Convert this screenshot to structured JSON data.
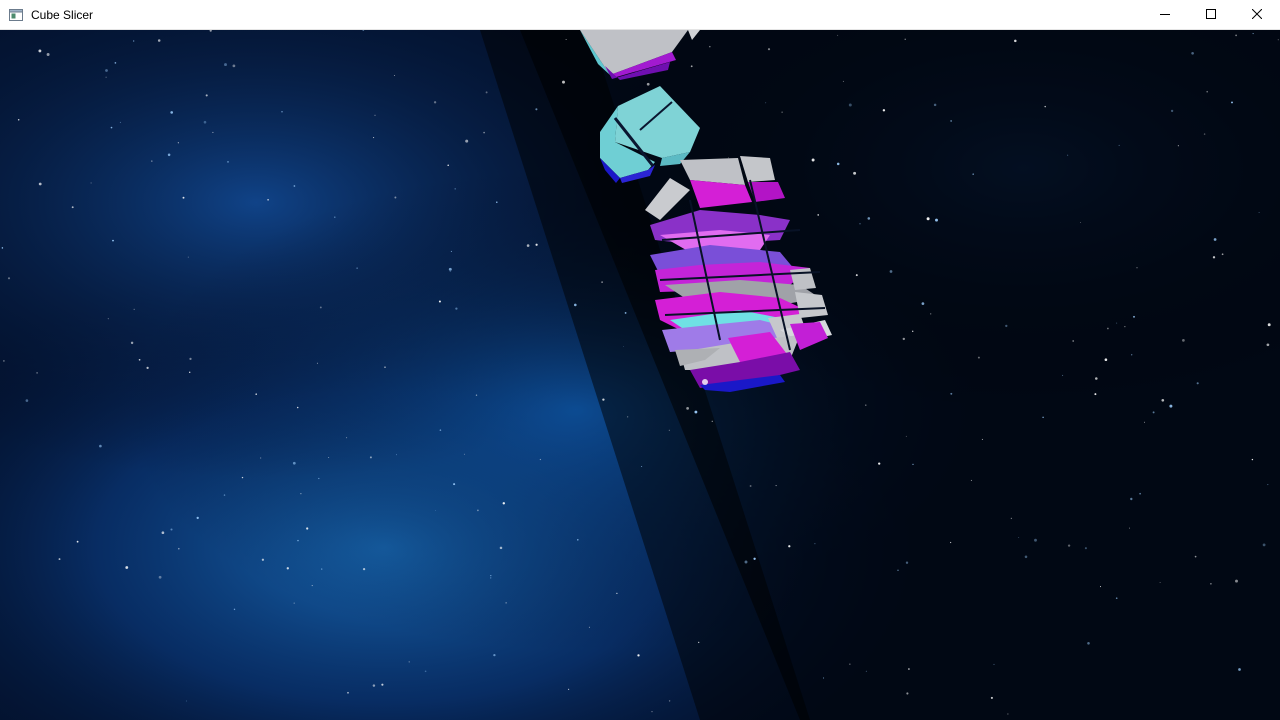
{
  "window": {
    "title": "Cube Slicer",
    "app_icon": "window-app-icon"
  },
  "controls": {
    "minimize_icon": "minimize-icon",
    "maximize_icon": "maximize-icon",
    "close_icon": "close-icon"
  },
  "scene": {
    "background": "space-nebula",
    "objects": [
      "sliced-cube-top",
      "sliced-cube-middle",
      "sliced-cube-shattered"
    ],
    "colors": {
      "nebula": "#0a4a9a",
      "cube_cyan": "#7fd3d6",
      "cube_magenta": "#c21fd6",
      "cube_purple": "#7a0da8",
      "cube_blue": "#1a18c8",
      "cube_gray": "#bfc1c6"
    }
  }
}
